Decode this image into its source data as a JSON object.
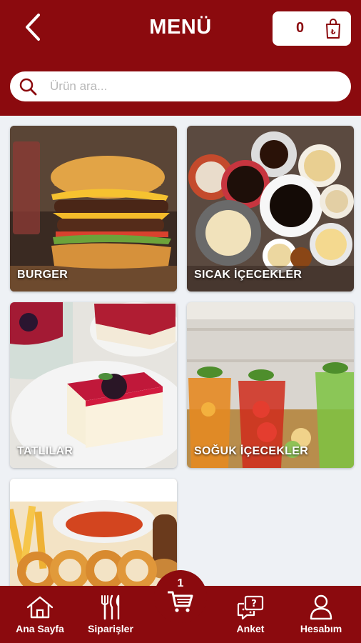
{
  "header": {
    "title": "MENÜ",
    "cart_count": "0"
  },
  "search": {
    "placeholder": "Ürün ara..."
  },
  "categories": [
    {
      "label": "BURGER"
    },
    {
      "label": "SICAK İÇECEKLER"
    },
    {
      "label": "TATLILAR"
    },
    {
      "label": "SOĞUK İÇECEKLER"
    },
    {
      "label": ""
    }
  ],
  "bottom_nav": {
    "home": "Ana Sayfa",
    "orders": "Siparişler",
    "cart_badge": "1",
    "survey": "Anket",
    "account": "Hesabım"
  },
  "colors": {
    "brand": "#8b0a0e",
    "background": "#eef1f5"
  }
}
